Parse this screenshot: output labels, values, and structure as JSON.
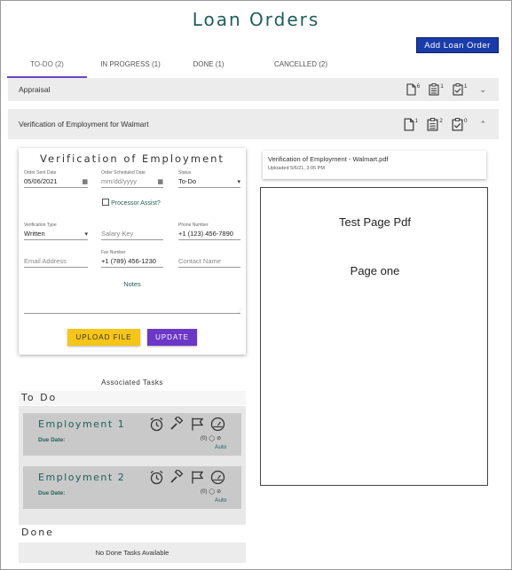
{
  "page_title": "Loan Orders",
  "add_button": "Add Loan Order",
  "tabs": [
    {
      "label": "TO-DO (2)",
      "active": true
    },
    {
      "label": "IN PROGRESS (1)",
      "active": false
    },
    {
      "label": "DONE (1)",
      "active": false
    },
    {
      "label": "CANCELLED (2)",
      "active": false
    }
  ],
  "accordions": [
    {
      "title": "Appraisal",
      "docs": "6",
      "tasks": "1",
      "done": "1",
      "expanded": false
    },
    {
      "title": "Verification of Employment for Walmart",
      "docs": "1",
      "tasks": "2",
      "done": "0",
      "expanded": true
    }
  ],
  "form": {
    "title": "Verification of Employment",
    "order_sent_label": "Order Sent Date",
    "order_sent_value": "05/06/2021",
    "order_scheduled_label": "Order Scheduled Date",
    "order_scheduled_placeholder": "mm/dd/yyyy",
    "status_label": "Status",
    "status_value": "To-Do",
    "processor_assist": "Processor Assist?",
    "verification_type_label": "Verification Type",
    "verification_type_value": "Written",
    "salary_key_placeholder": "Salary Key",
    "phone_label": "Phone Number",
    "phone_value": "+1 (123) 456-7890",
    "email_placeholder": "Email Address",
    "fax_label": "Fax Number",
    "fax_value": "+1 (789) 456-1230",
    "contact_placeholder": "Contact Name",
    "notes_label": "Notes",
    "upload_button": "UPLOAD FILE",
    "update_button": "UPDATE"
  },
  "document": {
    "name": "Verification of Employment - Walmart.pdf",
    "uploaded": "Uploaded 5/6/21, 3:05 PM"
  },
  "pdf_preview": {
    "line1": "Test Page Pdf",
    "line2": "Page one"
  },
  "associated_tasks": {
    "title": "Associated Tasks",
    "todo_header": "To Do",
    "tasks": [
      {
        "name": "Employment 1",
        "due_label": "Due Date:",
        "comments": "(0)",
        "mode": "Auto"
      },
      {
        "name": "Employment 2",
        "due_label": "Due Date:",
        "comments": "(0)",
        "mode": "Auto"
      }
    ],
    "done_header": "Done",
    "done_empty": "No Done Tasks Available"
  },
  "colors": {
    "accent_purple": "#6b37c6",
    "brand_blue": "#1a3ca8",
    "teal_text": "#1f5e5a",
    "upload_yellow": "#f5c518"
  }
}
